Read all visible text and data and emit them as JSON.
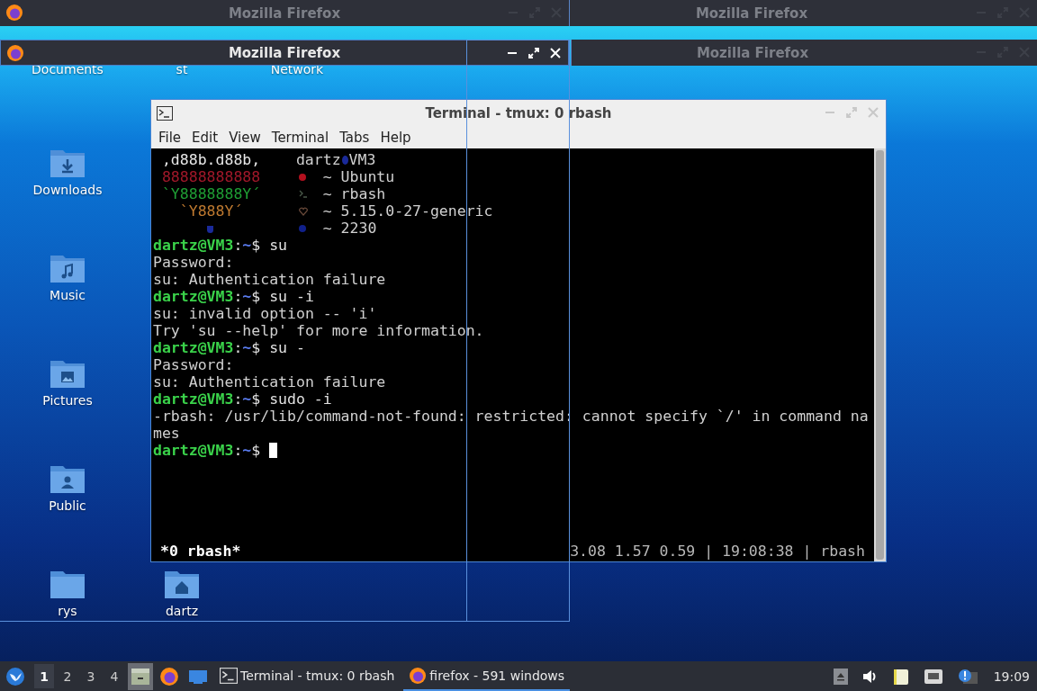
{
  "title_bars": [
    {
      "title": "Mozilla Firefox",
      "active": false
    },
    {
      "title": "Mozilla Firefox",
      "active": false
    },
    {
      "title": "Mozilla Firefox",
      "active": true
    },
    {
      "title": "Mozilla Firefox",
      "active": false
    }
  ],
  "desktop_icons": [
    {
      "label": "Documents",
      "kind": "covered"
    },
    {
      "label": "st",
      "kind": "covered"
    },
    {
      "label": "Network",
      "kind": "covered"
    },
    {
      "label": "Downloads",
      "kind": "download"
    },
    {
      "label": "Music",
      "kind": "music"
    },
    {
      "label": "Pictures",
      "kind": "picture"
    },
    {
      "label": "Public",
      "kind": "person"
    },
    {
      "label": "rys",
      "kind": "plain"
    },
    {
      "label": "dartz",
      "kind": "home"
    }
  ],
  "terminal": {
    "title": "Terminal - tmux: 0 rbash",
    "menu": [
      "File",
      "Edit",
      "View",
      "Terminal",
      "Tabs",
      "Help"
    ],
    "neofetch": [
      {
        "art": " ,d88b.d88b,",
        "color": "#e8e8e8",
        "kind": "header",
        "user": "dartz",
        "host": "VM3"
      },
      {
        "art": " 88888888888",
        "color": "#a3182a",
        "kind": "os",
        "text": "~ Ubuntu"
      },
      {
        "art": " `Y8888888Y´",
        "color": "#1fa035",
        "kind": "shell",
        "text": "~ rbash"
      },
      {
        "art": "   `Y888Y´",
        "color": "#c07a30",
        "kind": "kernel",
        "text": "~ 5.15.0-27-generic"
      },
      {
        "color": "#1a2a9a",
        "kind": "packages",
        "text": "~ 2230"
      }
    ],
    "lines": [
      {
        "kind": "prompt",
        "user": "dartz@VM3",
        "sep": ":",
        "path": "~",
        "symbol": "$",
        "command": "su"
      },
      {
        "kind": "output",
        "text": "Password:"
      },
      {
        "kind": "output",
        "text": "su: Authentication failure"
      },
      {
        "kind": "prompt",
        "user": "dartz@VM3",
        "sep": ":",
        "path": "~",
        "symbol": "$",
        "command": "su -i"
      },
      {
        "kind": "output",
        "text": "su: invalid option -- 'i'"
      },
      {
        "kind": "output",
        "text": "Try 'su --help' for more information."
      },
      {
        "kind": "prompt",
        "user": "dartz@VM3",
        "sep": ":",
        "path": "~",
        "symbol": "$",
        "command": "su -"
      },
      {
        "kind": "output",
        "text": "Password:"
      },
      {
        "kind": "output",
        "text": "su: Authentication failure"
      },
      {
        "kind": "prompt",
        "user": "dartz@VM3",
        "sep": ":",
        "path": "~",
        "symbol": "$",
        "command": "sudo -i"
      },
      {
        "kind": "output",
        "text": "-rbash: /usr/lib/command-not-found: restricted: cannot specify `/' in command na"
      },
      {
        "kind": "output",
        "text": "mes"
      },
      {
        "kind": "prompt",
        "user": "dartz@VM3",
        "sep": ":",
        "path": "~",
        "symbol": "$",
        "cursor": true
      }
    ],
    "status_left": "*0 rbash*",
    "status_right": "3.08 1.57 0.59 | 19:08:38 | rbash"
  },
  "taskbar": {
    "workspaces": [
      {
        "label": "1",
        "selected": true
      },
      {
        "label": "2",
        "selected": false
      },
      {
        "label": "3",
        "selected": false
      },
      {
        "label": "4",
        "selected": false
      }
    ],
    "launchers": [
      {
        "kind": "file-manager",
        "highlighted": true
      },
      {
        "kind": "firefox",
        "highlighted": false
      },
      {
        "kind": "folder",
        "highlighted": false
      }
    ],
    "tasks": [
      {
        "title": "Terminal - tmux: 0 rbash",
        "kind": "terminal",
        "selected": false
      },
      {
        "title": "firefox - 591 windows",
        "kind": "firefox",
        "selected": true
      }
    ],
    "clock": "19:09"
  }
}
